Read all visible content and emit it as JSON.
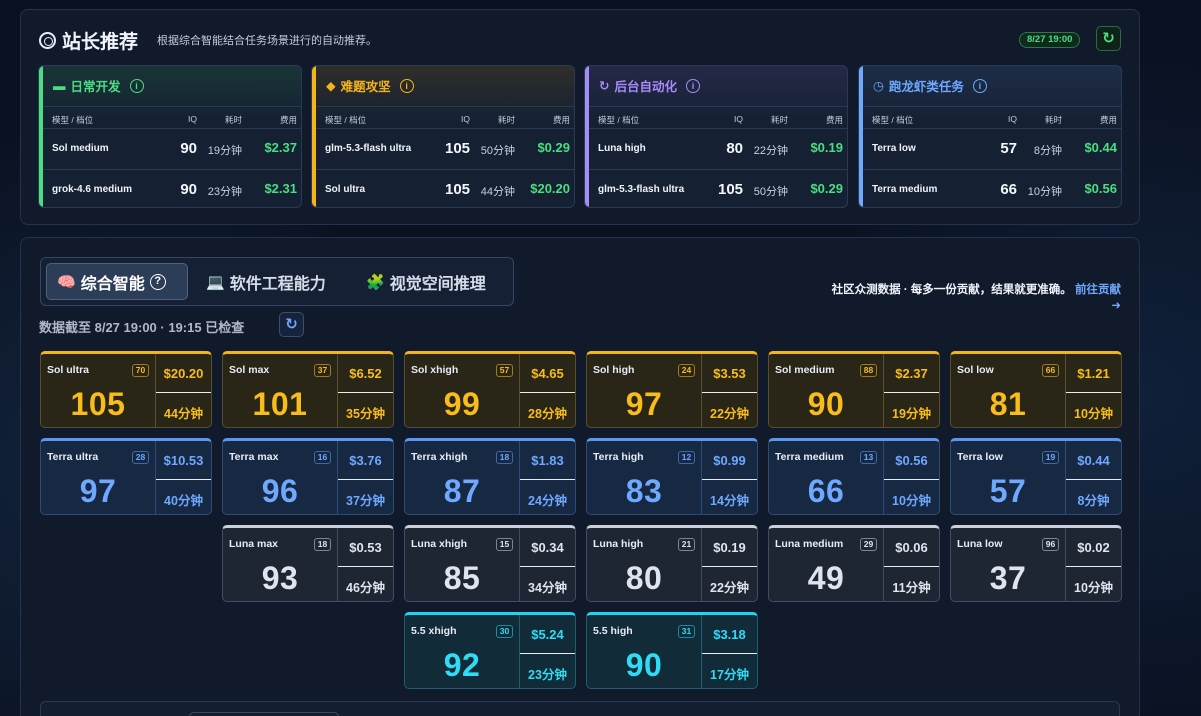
{
  "recommend": {
    "title": "站长推荐",
    "subtitle": "根据综合智能结合任务场景进行的自动推荐。",
    "timestamp": "8/27 19:00",
    "columns": {
      "model": "模型 / 档位",
      "iq": "IQ",
      "time": "耗时",
      "cost": "费用"
    },
    "categories": [
      {
        "icon": "▬",
        "label": "日常开发",
        "color": "#4ade80",
        "rows": [
          {
            "model": "Sol medium",
            "iq": "90",
            "time": "19分钟",
            "cost": "$2.37"
          },
          {
            "model": "grok-4.6 medium",
            "iq": "90",
            "time": "23分钟",
            "cost": "$2.31"
          }
        ]
      },
      {
        "icon": "◆",
        "label": "难题攻坚",
        "color": "#f4b41a",
        "rows": [
          {
            "model": "glm-5.3-flash ultra",
            "iq": "105",
            "time": "50分钟",
            "cost": "$0.29"
          },
          {
            "model": "Sol ultra",
            "iq": "105",
            "time": "44分钟",
            "cost": "$20.20"
          }
        ]
      },
      {
        "icon": "↻",
        "label": "后台自动化",
        "color": "#a78bfa",
        "rows": [
          {
            "model": "Luna high",
            "iq": "80",
            "time": "22分钟",
            "cost": "$0.19"
          },
          {
            "model": "glm-5.3-flash ultra",
            "iq": "105",
            "time": "50分钟",
            "cost": "$0.29"
          }
        ]
      },
      {
        "icon": "◷",
        "label": "跑龙虾类任务",
        "color": "#6ea8ff",
        "rows": [
          {
            "model": "Terra low",
            "iq": "57",
            "time": "8分钟",
            "cost": "$0.44"
          },
          {
            "model": "Terra medium",
            "iq": "66",
            "time": "10分钟",
            "cost": "$0.56"
          }
        ]
      }
    ]
  },
  "leaderboard": {
    "tabs": [
      {
        "icon": "🧠",
        "label": "综合智能",
        "help": "?"
      },
      {
        "icon": "💻",
        "label": "软件工程能力"
      },
      {
        "icon": "🧩",
        "label": "视觉空间推理"
      }
    ],
    "community_text": "社区众测数据 · 每多一份贡献，结果就更准确。",
    "community_link": "前往贡献",
    "community_arrow": "➜",
    "data_checked": "数据截至 8/27 19:00 · 19:15 已检查",
    "refresh_icon": "↻",
    "rows": [
      {
        "theme": "gold",
        "cards": [
          {
            "name": "Sol ultra",
            "rank": "70",
            "iq": "105",
            "cost": "$20.20",
            "time": "44分钟"
          },
          {
            "name": "Sol max",
            "rank": "37",
            "iq": "101",
            "cost": "$6.52",
            "time": "35分钟"
          },
          {
            "name": "Sol xhigh",
            "rank": "57",
            "iq": "99",
            "cost": "$4.65",
            "time": "28分钟"
          },
          {
            "name": "Sol high",
            "rank": "24",
            "iq": "97",
            "cost": "$3.53",
            "time": "22分钟"
          },
          {
            "name": "Sol medium",
            "rank": "88",
            "iq": "90",
            "cost": "$2.37",
            "time": "19分钟"
          },
          {
            "name": "Sol low",
            "rank": "66",
            "iq": "81",
            "cost": "$1.21",
            "time": "10分钟"
          }
        ]
      },
      {
        "theme": "blue",
        "cards": [
          {
            "name": "Terra ultra",
            "rank": "28",
            "iq": "97",
            "cost": "$10.53",
            "time": "40分钟"
          },
          {
            "name": "Terra max",
            "rank": "16",
            "iq": "96",
            "cost": "$3.76",
            "time": "37分钟"
          },
          {
            "name": "Terra xhigh",
            "rank": "18",
            "iq": "87",
            "cost": "$1.83",
            "time": "24分钟"
          },
          {
            "name": "Terra high",
            "rank": "12",
            "iq": "83",
            "cost": "$0.99",
            "time": "14分钟"
          },
          {
            "name": "Terra medium",
            "rank": "13",
            "iq": "66",
            "cost": "$0.56",
            "time": "10分钟"
          },
          {
            "name": "Terra low",
            "rank": "19",
            "iq": "57",
            "cost": "$0.44",
            "time": "8分钟"
          }
        ]
      },
      {
        "theme": "gray",
        "cards": [
          null,
          {
            "name": "Luna max",
            "rank": "18",
            "iq": "93",
            "cost": "$0.53",
            "time": "46分钟"
          },
          {
            "name": "Luna xhigh",
            "rank": "15",
            "iq": "85",
            "cost": "$0.34",
            "time": "34分钟"
          },
          {
            "name": "Luna high",
            "rank": "21",
            "iq": "80",
            "cost": "$0.19",
            "time": "22分钟"
          },
          {
            "name": "Luna medium",
            "rank": "29",
            "iq": "49",
            "cost": "$0.06",
            "time": "11分钟"
          },
          {
            "name": "Luna low",
            "rank": "96",
            "iq": "37",
            "cost": "$0.02",
            "time": "10分钟"
          }
        ]
      },
      {
        "theme": "cyan",
        "cards": [
          null,
          null,
          {
            "name": "5.5 xhigh",
            "rank": "30",
            "iq": "92",
            "cost": "$5.24",
            "time": "23分钟"
          },
          {
            "name": "5.5 high",
            "rank": "31",
            "iq": "90",
            "cost": "$3.18",
            "time": "17分钟"
          }
        ]
      }
    ]
  }
}
